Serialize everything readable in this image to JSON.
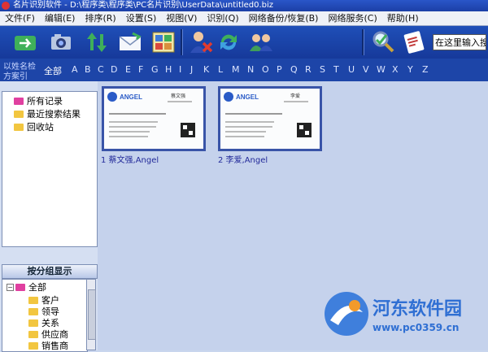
{
  "window": {
    "title": "名片识别软件 - D:\\程序类\\程序类\\PC名片识别\\UserData\\untitled0.biz"
  },
  "menu": [
    "文件(F)",
    "编辑(E)",
    "排序(R)",
    "设置(S)",
    "视图(V)",
    "识别(Q)",
    "网络备份/恢复(B)",
    "网络服务(C)",
    "帮助(H)"
  ],
  "toolbar": {
    "buttons": [
      "import-icon",
      "camera-icon",
      "sort-icon",
      "envelope-icon",
      "grid-view-icon",
      "delete-user-icon",
      "sync-icon",
      "contacts-icon",
      "search-icon",
      "card-scan-icon"
    ],
    "search_value": "在这里输入搜"
  },
  "alphabet_bar": {
    "mode_top": "以姓名检",
    "mode_bottom": "方案引",
    "all_label": "全部",
    "letters": [
      "A",
      "B",
      "C",
      "D",
      "E",
      "F",
      "G",
      "H",
      "I",
      "J",
      "K",
      "L",
      "M",
      "N",
      "O",
      "P",
      "Q",
      "R",
      "S",
      "T",
      "U",
      "V",
      "W",
      "X",
      "Y",
      "Z"
    ]
  },
  "tree": {
    "items": [
      {
        "label": "所有记录",
        "color": "#e040a0"
      },
      {
        "label": "最近搜索结果",
        "color": "#f2c640"
      },
      {
        "label": "回收站",
        "color": "#f2c640"
      }
    ]
  },
  "groups": {
    "header": "按分组显示",
    "root": "全部",
    "items": [
      "客户",
      "领导",
      "关系",
      "供应商",
      "销售商"
    ]
  },
  "cards": [
    {
      "caption": "1 蔡文强,Angel",
      "brand": "ANGEL",
      "name": "蔡文强"
    },
    {
      "caption": "2 李爱,Angel",
      "brand": "ANGEL",
      "name": "李爱"
    }
  ],
  "watermark": {
    "text": "河东软件园",
    "url": "www.pc0359.cn"
  }
}
